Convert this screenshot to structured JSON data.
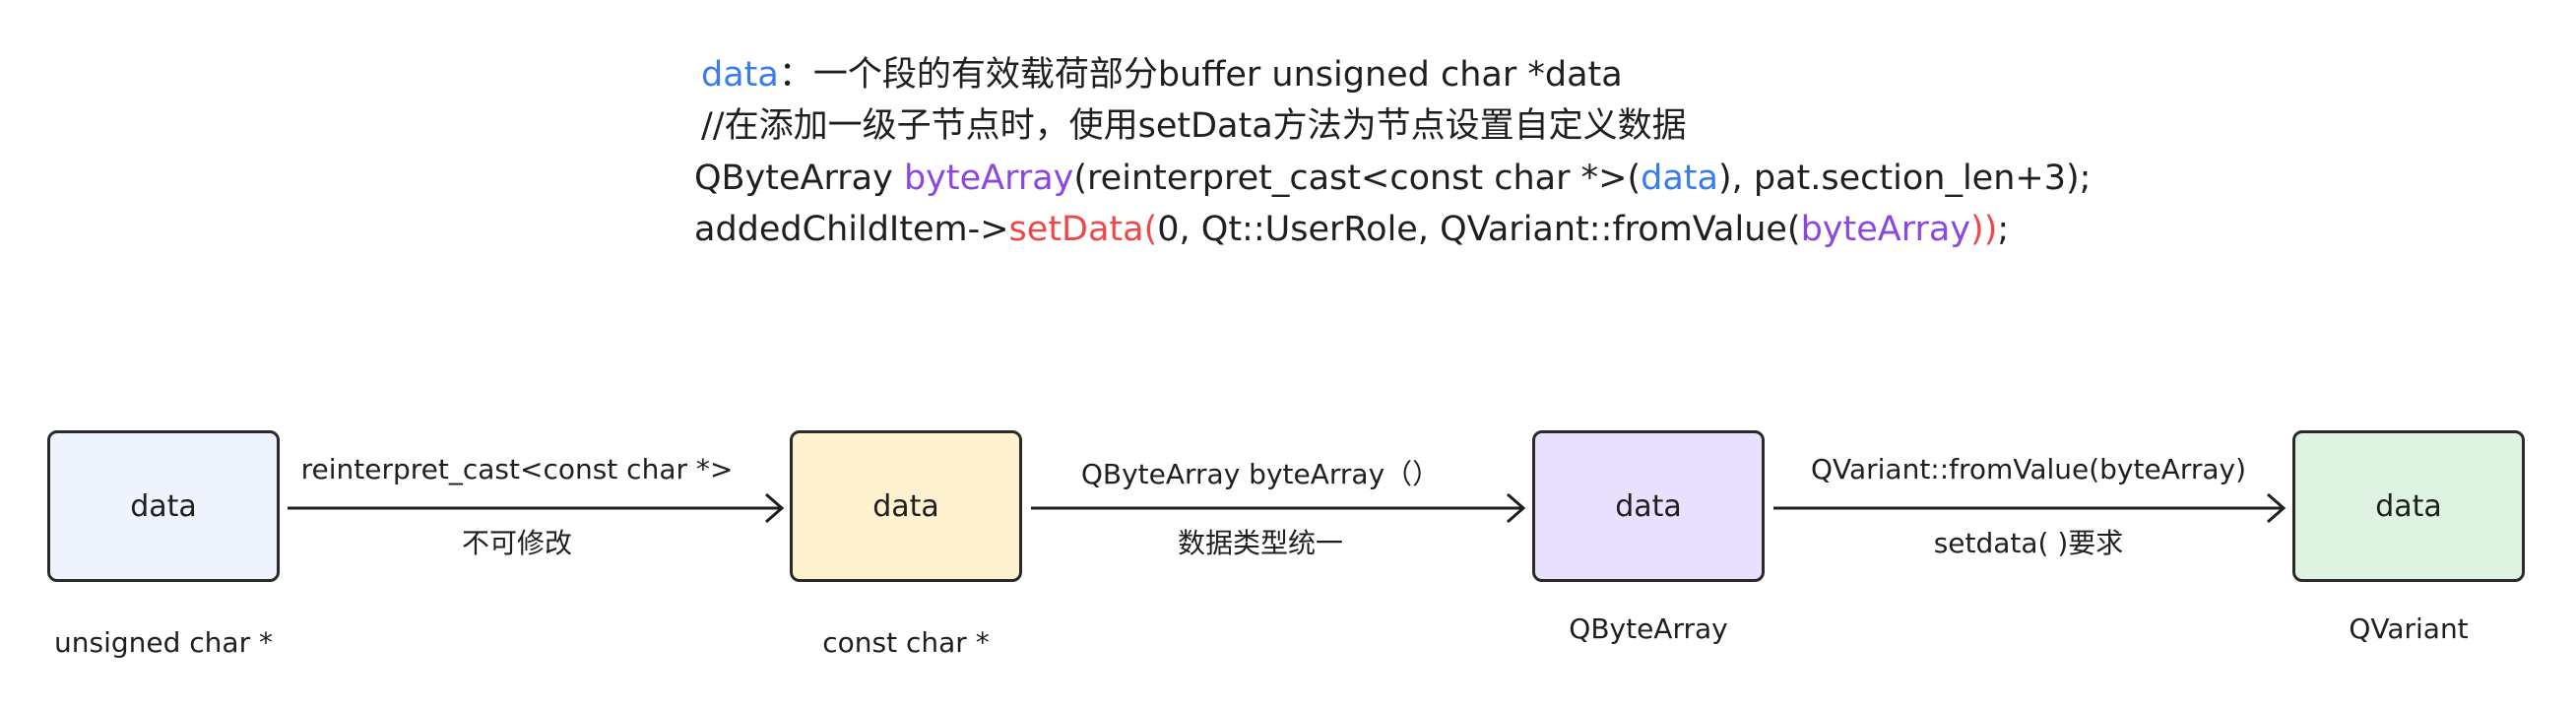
{
  "code": {
    "line1": {
      "var": "data",
      "rest": "：一个段的有效载荷部分buffer unsigned char *data"
    },
    "line2": {
      "text": "//在添加一级子节点时，使用setData方法为节点设置自定义数据"
    },
    "line3": {
      "part1": "QByteArray ",
      "ident": "byteArray",
      "part2": "(reinterpret_cast<const char *>(",
      "var": "data",
      "part3": "), pat.section_len+3);"
    },
    "line4": {
      "part1": "addedChildItem->",
      "method": "setData(",
      "part2": "0, Qt::UserRole, QVariant::fromValue(",
      "ident": "byteArray",
      "close": "))",
      "end": ";"
    }
  },
  "diagram": {
    "nodes": [
      {
        "label": "data",
        "caption": "unsigned char *",
        "fill": "#eef3fd"
      },
      {
        "label": "data",
        "caption": "const char *",
        "fill": "#fdf1d0"
      },
      {
        "label": "data",
        "caption": "QByteArray",
        "fill": "#e8e0fc"
      },
      {
        "label": "data",
        "caption": "QVariant",
        "fill": "#dff3e3"
      }
    ],
    "edges": [
      {
        "top_label": "reinterpret_cast<const char *>",
        "bottom_label": "不可修改"
      },
      {
        "top_label": "QByteArray byteArray（）",
        "bottom_label": "数据类型统一"
      },
      {
        "top_label": "QVariant::fromValue(byteArray)",
        "bottom_label": "setdata( )要求"
      }
    ]
  }
}
